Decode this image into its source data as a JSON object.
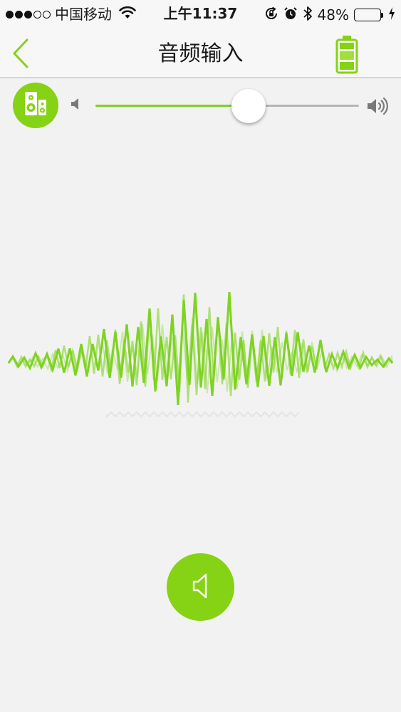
{
  "status_bar": {
    "carrier": "中国移动",
    "time": "上午11:37",
    "battery_percent_text": "48%",
    "battery_level": 0.48,
    "signal_bars_filled": 3,
    "signal_bars_total": 5
  },
  "nav": {
    "title": "音频输入",
    "back_icon": "chevron-left-icon",
    "right_icon": "battery-icon"
  },
  "volume": {
    "level": 0.58,
    "min_icon": "volume-low-icon",
    "max_icon": "volume-high-icon",
    "source_icon": "speaker-icon"
  },
  "bottom_button": {
    "icon": "speaker-outline-icon"
  },
  "colors": {
    "accent": "#86d214",
    "slider_fill": "#7cd02a",
    "wave": "#7ed321",
    "background": "#f2f2f2"
  }
}
